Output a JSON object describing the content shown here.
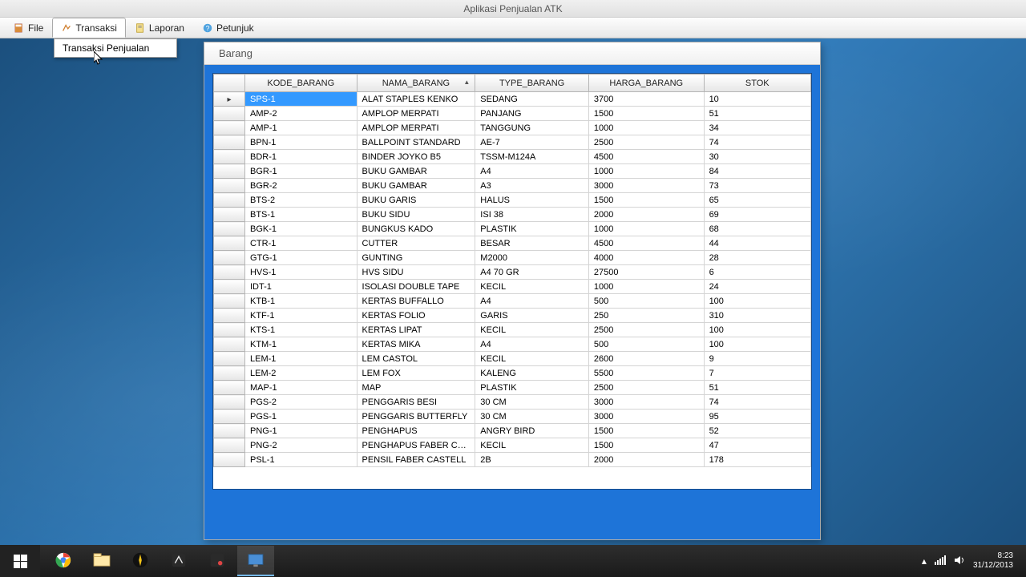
{
  "app_title": "Aplikasi Penjualan ATK",
  "menubar": {
    "file": "File",
    "transaksi": "Transaksi",
    "laporan": "Laporan",
    "petunjuk": "Petunjuk"
  },
  "dropdown": {
    "item0": "Transaksi Penjualan"
  },
  "window": {
    "title": "Barang"
  },
  "columns": {
    "kode": "KODE_BARANG",
    "nama": "NAMA_BARANG",
    "type": "TYPE_BARANG",
    "harga": "HARGA_BARANG",
    "stok": "STOK"
  },
  "rows": [
    {
      "kode": "SPS-1",
      "nama": "ALAT STAPLES KENKO",
      "type": "SEDANG",
      "harga": "3700",
      "stok": "10"
    },
    {
      "kode": "AMP-2",
      "nama": "AMPLOP MERPATI",
      "type": "PANJANG",
      "harga": "1500",
      "stok": "51"
    },
    {
      "kode": "AMP-1",
      "nama": "AMPLOP MERPATI",
      "type": "TANGGUNG",
      "harga": "1000",
      "stok": "34"
    },
    {
      "kode": "BPN-1",
      "nama": "BALLPOINT STANDARD",
      "type": "AE-7",
      "harga": "2500",
      "stok": "74"
    },
    {
      "kode": "BDR-1",
      "nama": "BINDER JOYKO B5",
      "type": "TSSM-M124A",
      "harga": "4500",
      "stok": "30"
    },
    {
      "kode": "BGR-1",
      "nama": "BUKU GAMBAR",
      "type": "A4",
      "harga": "1000",
      "stok": "84"
    },
    {
      "kode": "BGR-2",
      "nama": "BUKU GAMBAR",
      "type": "A3",
      "harga": "3000",
      "stok": "73"
    },
    {
      "kode": "BTS-2",
      "nama": "BUKU GARIS",
      "type": "HALUS",
      "harga": "1500",
      "stok": "65"
    },
    {
      "kode": "BTS-1",
      "nama": "BUKU SIDU",
      "type": "ISI 38",
      "harga": "2000",
      "stok": "69"
    },
    {
      "kode": "BGK-1",
      "nama": "BUNGKUS KADO",
      "type": "PLASTIK",
      "harga": "1000",
      "stok": "68"
    },
    {
      "kode": "CTR-1",
      "nama": "CUTTER",
      "type": "BESAR",
      "harga": "4500",
      "stok": "44"
    },
    {
      "kode": "GTG-1",
      "nama": "GUNTING",
      "type": "M2000",
      "harga": "4000",
      "stok": "28"
    },
    {
      "kode": "HVS-1",
      "nama": "HVS SIDU",
      "type": "A4 70 GR",
      "harga": "27500",
      "stok": "6"
    },
    {
      "kode": "IDT-1",
      "nama": "ISOLASI DOUBLE TAPE",
      "type": "KECIL",
      "harga": "1000",
      "stok": "24"
    },
    {
      "kode": "KTB-1",
      "nama": "KERTAS BUFFALLO",
      "type": "A4",
      "harga": "500",
      "stok": "100"
    },
    {
      "kode": "KTF-1",
      "nama": "KERTAS FOLIO",
      "type": "GARIS",
      "harga": "250",
      "stok": "310"
    },
    {
      "kode": "KTS-1",
      "nama": "KERTAS LIPAT",
      "type": "KECIL",
      "harga": "2500",
      "stok": "100"
    },
    {
      "kode": "KTM-1",
      "nama": "KERTAS MIKA",
      "type": "A4",
      "harga": "500",
      "stok": "100"
    },
    {
      "kode": "LEM-1",
      "nama": "LEM CASTOL",
      "type": "KECIL",
      "harga": "2600",
      "stok": "9"
    },
    {
      "kode": "LEM-2",
      "nama": "LEM FOX",
      "type": "KALENG",
      "harga": "5500",
      "stok": "7"
    },
    {
      "kode": "MAP-1",
      "nama": "MAP",
      "type": "PLASTIK",
      "harga": "2500",
      "stok": "51"
    },
    {
      "kode": "PGS-2",
      "nama": "PENGGARIS BESI",
      "type": "30 CM",
      "harga": "3000",
      "stok": "74"
    },
    {
      "kode": "PGS-1",
      "nama": "PENGGARIS BUTTERFLY",
      "type": "30 CM",
      "harga": "3000",
      "stok": "95"
    },
    {
      "kode": "PNG-1",
      "nama": "PENGHAPUS",
      "type": "ANGRY BIRD",
      "harga": "1500",
      "stok": "52"
    },
    {
      "kode": "PNG-2",
      "nama": "PENGHAPUS FABER CAS...",
      "type": "KECIL",
      "harga": "1500",
      "stok": "47"
    },
    {
      "kode": "PSL-1",
      "nama": "PENSIL FABER CASTELL",
      "type": "2B",
      "harga": "2000",
      "stok": "178"
    }
  ],
  "tray": {
    "time": "8:23",
    "date": "31/12/2013"
  }
}
